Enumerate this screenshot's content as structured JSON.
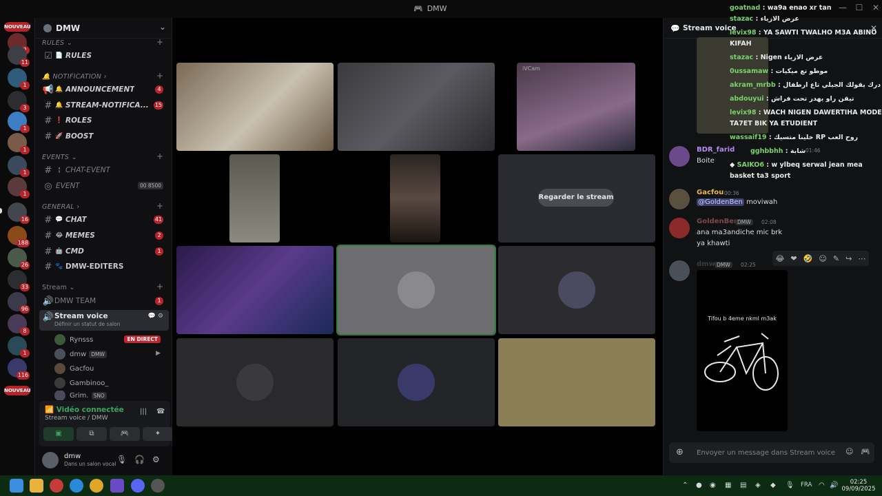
{
  "window": {
    "title": "DMW"
  },
  "rail": {
    "nouveau_top": "NOUVEAU",
    "nouveau_bottom": "NOUVEAU",
    "badges": [
      "2",
      "11",
      "1",
      "3",
      "1",
      "1",
      "1",
      "1",
      "16",
      "188",
      "26",
      "33",
      "96",
      "8",
      "1",
      "116"
    ]
  },
  "sidebar": {
    "guild_name": "DMW",
    "categories": {
      "rules": "RULES",
      "notification": "NOTIFICATION",
      "events": "EVENTS",
      "general": "GENERAL",
      "stream": "Stream"
    },
    "channels": {
      "rules": {
        "label": "RULES",
        "emoji": "📄"
      },
      "announcement": {
        "label": "ANNOUNCEMENT",
        "count": "4"
      },
      "stream_notif": {
        "label": "STREAM-NOTIFICA...",
        "count": "15"
      },
      "roles": {
        "label": "ROLES"
      },
      "boost": {
        "label": "BOOST"
      },
      "chat_event": {
        "label": "CHAT-EVENT"
      },
      "event": {
        "label": "EVENT",
        "badge": "00 8500"
      },
      "chat": {
        "label": "CHAT",
        "count": "41"
      },
      "memes": {
        "label": "MEMES",
        "count": "2"
      },
      "cmd": {
        "label": "CMD",
        "count": "1"
      },
      "editers": {
        "label": "DMW-EDITERS"
      },
      "dmw_team": {
        "label": "DMW TEAM",
        "count": "1"
      },
      "stream_voice": {
        "label": "Stream voice",
        "status": "Définir un statut de salon"
      }
    },
    "voice_users": [
      {
        "name": "Rynsss",
        "live": "EN DIRECT"
      },
      {
        "name": "dmw",
        "tag": "DMW"
      },
      {
        "name": "Gacfou"
      },
      {
        "name": "Gambinoo_"
      },
      {
        "name": "Grim.",
        "tag": "SNO"
      }
    ],
    "voice_panel": {
      "title": "Vidéo connectée",
      "subtitle": "Stream voice / DMW"
    },
    "user": {
      "name": "dmw",
      "status": "Dans un salon vocal"
    }
  },
  "stage": {
    "watch_label": "Regarder le stream",
    "cam_label": "iVCam"
  },
  "chat": {
    "header": "Stream voice",
    "overlay": [
      {
        "user": "goatnad",
        "text": "wa9a enao xr tan"
      },
      {
        "user": "stazac",
        "text": "عرض الازياء"
      },
      {
        "user": "levix98",
        "text": "YA SAWTI TWALHO M3A ABINO"
      },
      {
        "user": "",
        "text": "KIFAH"
      },
      {
        "user": "stazac",
        "text": "Nigen عرض الازياء"
      },
      {
        "user": "0ussamaw",
        "text": "موطو تع ميكيات"
      },
      {
        "user": "akram_mrbb",
        "text": "درك يقولك الجيلي تاع ارطفال"
      },
      {
        "user": "abdouyui",
        "text": "تيقن راو يهدر تحت فراش"
      },
      {
        "user": "levix98",
        "text": "WACH NIGEN DAWERTIHA MODEL"
      },
      {
        "user": "",
        "text": "TA7ET BIK YA ETUDIENT"
      },
      {
        "user": "wassaif19",
        "text": "خلينا متسيك RP روح العب"
      },
      {
        "user": "gghbbhh",
        "text": "شابة"
      },
      {
        "user": "SAIKO6",
        "text": "w ylbeq serwal jean mea"
      },
      {
        "user": "",
        "text": "basket ta3 sport"
      }
    ],
    "messages": [
      {
        "author": "BDR_farid",
        "time": "01:46",
        "body": "Boite",
        "color": "#b48cf0"
      },
      {
        "author": "Gacfou",
        "time": "00:36",
        "body": "moviwah",
        "mention": "@GoldenBen",
        "color": "#e9b84a"
      },
      {
        "author": "GoldenBen",
        "time": "02:08",
        "tag": "DMW",
        "body": "ana ma3andiche mic brk",
        "body2": "ya khawti",
        "color": "#7b4a4a"
      },
      {
        "author": "dmw",
        "time": "02:25",
        "tag": "DMW",
        "color": "#6b6f77"
      }
    ],
    "sticker_text": "Tifou b 4eme nkml m3ak",
    "composer_placeholder": "Envoyer un message dans Stream voice"
  },
  "taskbar": {
    "lang": "FRA",
    "time": "02:25",
    "date": "09/09/2025"
  }
}
